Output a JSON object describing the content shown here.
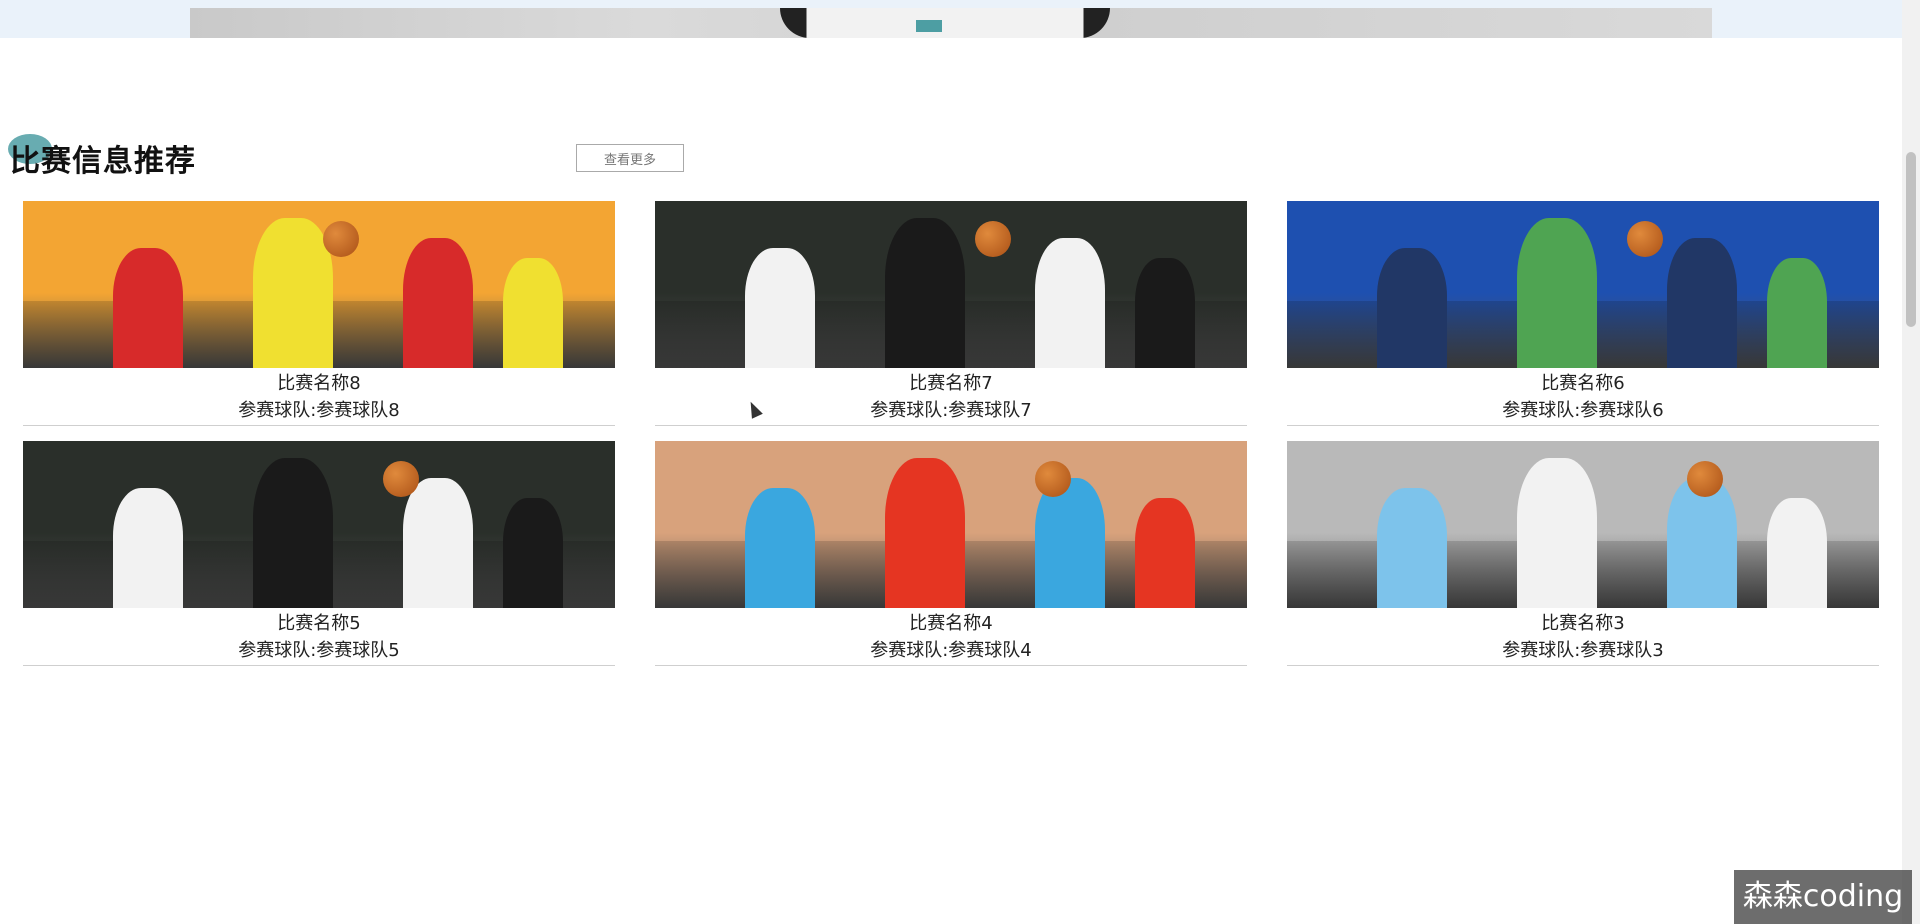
{
  "section": {
    "title": "比赛信息推荐",
    "more_button": "查看更多"
  },
  "cards": [
    {
      "name": "比赛名称8",
      "team": "参赛球队:参赛球队8",
      "palette": [
        "#f3a533",
        "#d72a2a",
        "#f0e030"
      ]
    },
    {
      "name": "比赛名称7",
      "team": "参赛球队:参赛球队7",
      "palette": [
        "#2a2f2a",
        "#f2f2f2",
        "#1a1a1a"
      ]
    },
    {
      "name": "比赛名称6",
      "team": "参赛球队:参赛球队6",
      "palette": [
        "#1e50b0",
        "#213766",
        "#4fa452"
      ]
    },
    {
      "name": "比赛名称5",
      "team": "参赛球队:参赛球队5",
      "palette": [
        "#2a2f2a",
        "#f2f2f2",
        "#1a1a1a"
      ]
    },
    {
      "name": "比赛名称4",
      "team": "参赛球队:参赛球队4",
      "palette": [
        "#d8a27c",
        "#3aa7df",
        "#e53522"
      ]
    },
    {
      "name": "比赛名称3",
      "team": "参赛球队:参赛球队3",
      "palette": [
        "#b9b9b9",
        "#7dc3eb",
        "#f2f2f2"
      ]
    }
  ],
  "watermark": "森森coding",
  "icons": {
    "cursor": "mouse-pointer-icon"
  }
}
